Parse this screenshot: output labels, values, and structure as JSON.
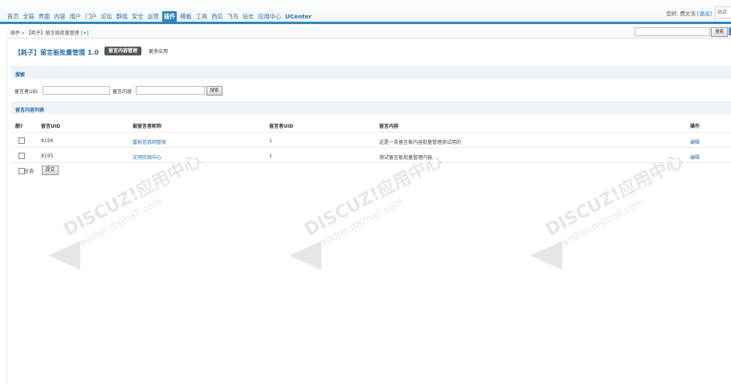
{
  "topnav": {
    "items": [
      "首页",
      "全局",
      "界面",
      "内容",
      "用户",
      "门户",
      "论坛",
      "群组",
      "安全",
      "运营",
      "插件",
      "模板",
      "工具",
      "西瓜",
      "飞鸟",
      "站长",
      "应用中心",
      "UCenter"
    ],
    "active_index": 10
  },
  "user": {
    "greeting": "您好, 费文浩",
    "logout": "[退出]",
    "site": "站点"
  },
  "breadcrumb": {
    "path": "插件 » 【耗子】留言板批量管理",
    "add": "[+]"
  },
  "header_search": {
    "button": "搜索",
    "button2": "站"
  },
  "plugin": {
    "title": "【耗子】留言板批量管理 1.0",
    "tab_manage": "留言内容管理",
    "tab_more": "更多应用"
  },
  "search": {
    "section_title": "搜索",
    "uid_label": "留言者UID",
    "content_label": "留言内容",
    "button": "搜索"
  },
  "list": {
    "section_title": "留言内容列表",
    "columns": [
      "删?",
      "留言UID",
      "被留言者昵称",
      "留言者UID",
      "留言内容",
      "操作"
    ],
    "rows": [
      {
        "uid": "8196",
        "nickname": "富裕信息网管家",
        "author_uid": "1",
        "content": "这是一条留言板内容批量管理测试用的",
        "action": "编辑"
      },
      {
        "uid": "8195",
        "nickname": "文明实践中心",
        "author_uid": "1",
        "content": "测试留言板批量管理内容",
        "action": "编辑"
      }
    ],
    "select_all": "全选",
    "submit": "提交"
  },
  "watermark": {
    "brand": "DISCUZ!应用中心",
    "site": "addon.dismall.com",
    "mark": "貮道"
  }
}
